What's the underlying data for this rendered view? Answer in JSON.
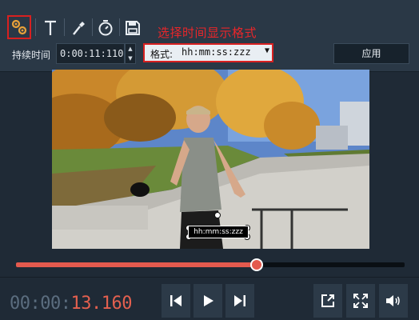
{
  "toolbar": {
    "tools": [
      {
        "icon": "gear-pair-icon",
        "selected": true
      },
      {
        "icon": "text-icon",
        "selected": false
      },
      {
        "icon": "eyedropper-icon",
        "selected": false
      },
      {
        "icon": "stopwatch-icon",
        "selected": false
      },
      {
        "icon": "save-icon",
        "selected": false
      }
    ],
    "annotation": "选择时间显示格式",
    "duration_label": "持续时间",
    "duration_value": "0:00:11:110",
    "format_label": "格式:",
    "format_value": "hh:mm:ss:zzz",
    "apply_label": "应用"
  },
  "video": {
    "overlay_text": "hh:mm:ss:zzz"
  },
  "timeline": {
    "progress": 0.62
  },
  "timecode": {
    "dim_part": "00:00:",
    "lit_part": "13.160"
  },
  "controls": {
    "buttons": [
      "skip-back-icon",
      "play-icon",
      "skip-forward-icon",
      "export-icon",
      "fullscreen-icon",
      "volume-icon"
    ]
  },
  "colors": {
    "accent": "#e45a4e",
    "highlight_border": "#d82020",
    "background": "#1f2a36"
  }
}
